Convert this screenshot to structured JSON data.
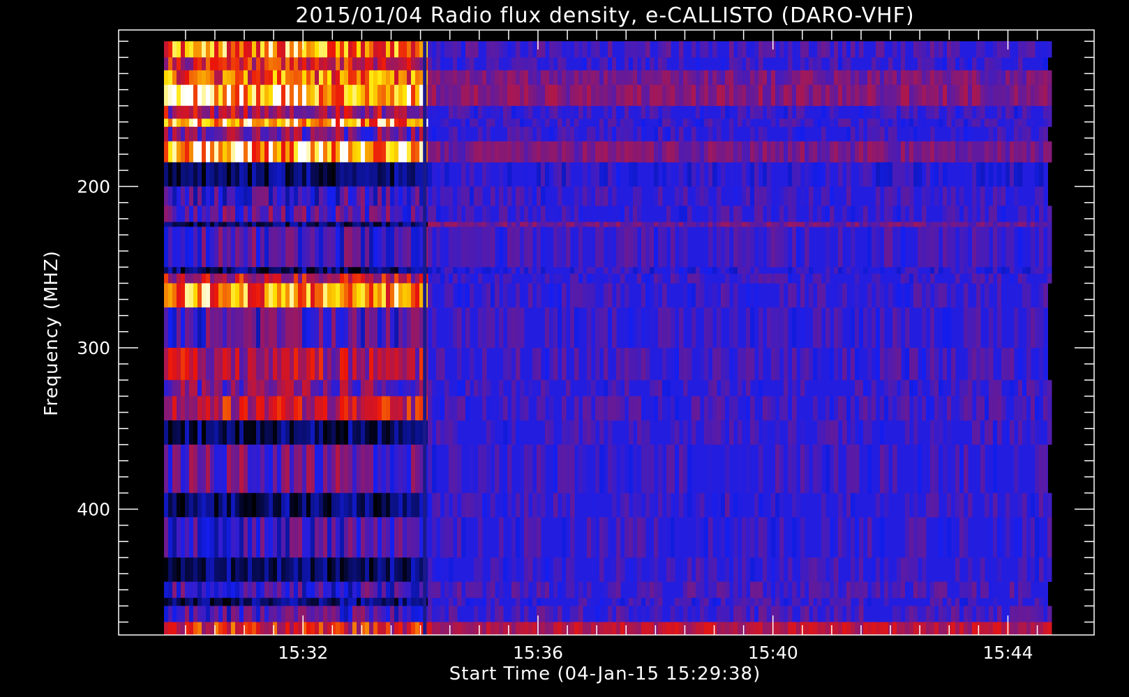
{
  "chart_data": {
    "type": "heatmap",
    "title": "2015/01/04  Radio flux density, e-CALLISTO (DARO-VHF)",
    "xlabel": "Start Time (04-Jan-15 15:29:38)",
    "ylabel": "Frequency (MHZ)",
    "x_ticks": [
      "15:32",
      "15:36",
      "15:40",
      "15:44"
    ],
    "y_ticks": [
      200,
      300,
      400
    ],
    "x_range": [
      "15:29:38",
      "15:44:41"
    ],
    "ylim": [
      478,
      103
    ],
    "ylim_note_removed": true,
    "event": {
      "time": "15:34:04"
    },
    "bands": [
      {
        "f0": 110,
        "f1": 120,
        "intensity_before": 0.85,
        "intensity_after": 0.15
      },
      {
        "f0": 120,
        "f1": 128,
        "intensity_before": 0.55,
        "intensity_after": 0.1
      },
      {
        "f0": 128,
        "f1": 137,
        "intensity_before": 0.75,
        "intensity_after": 0.3
      },
      {
        "f0": 137,
        "f1": 150,
        "intensity_before": 0.95,
        "intensity_after": 0.35
      },
      {
        "f0": 150,
        "f1": 158,
        "intensity_before": 0.45,
        "intensity_after": 0.1
      },
      {
        "f0": 158,
        "f1": 163,
        "intensity_before": 0.9,
        "intensity_after": 0.1
      },
      {
        "f0": 163,
        "f1": 172,
        "intensity_before": 0.3,
        "intensity_after": 0.1
      },
      {
        "f0": 172,
        "f1": 185,
        "intensity_before": 0.95,
        "intensity_after": 0.3
      },
      {
        "f0": 185,
        "f1": 200,
        "intensity_before": 0.05,
        "intensity_after": 0.05
      },
      {
        "f0": 200,
        "f1": 212,
        "intensity_before": 0.1,
        "intensity_after": 0.1
      },
      {
        "f0": 212,
        "f1": 222,
        "intensity_before": 0.2,
        "intensity_after": 0.1
      },
      {
        "f0": 222,
        "f1": 225,
        "intensity_before": 0.0,
        "intensity_after": 0.3
      },
      {
        "f0": 225,
        "f1": 250,
        "intensity_before": 0.15,
        "intensity_after": 0.12
      },
      {
        "f0": 250,
        "f1": 254,
        "intensity_before": 0.0,
        "intensity_after": 0.05
      },
      {
        "f0": 254,
        "f1": 260,
        "intensity_before": 0.5,
        "intensity_after": 0.1
      },
      {
        "f0": 260,
        "f1": 275,
        "intensity_before": 0.85,
        "intensity_after": 0.1
      },
      {
        "f0": 275,
        "f1": 300,
        "intensity_before": 0.15,
        "intensity_after": 0.1
      },
      {
        "f0": 300,
        "f1": 320,
        "intensity_before": 0.45,
        "intensity_after": 0.12
      },
      {
        "f0": 320,
        "f1": 330,
        "intensity_before": 0.3,
        "intensity_after": 0.1
      },
      {
        "f0": 330,
        "f1": 345,
        "intensity_before": 0.55,
        "intensity_after": 0.12
      },
      {
        "f0": 345,
        "f1": 360,
        "intensity_before": 0.05,
        "intensity_after": 0.1
      },
      {
        "f0": 360,
        "f1": 390,
        "intensity_before": 0.25,
        "intensity_after": 0.1
      },
      {
        "f0": 390,
        "f1": 405,
        "intensity_before": 0.05,
        "intensity_after": 0.1
      },
      {
        "f0": 405,
        "f1": 430,
        "intensity_before": 0.1,
        "intensity_after": 0.1
      },
      {
        "f0": 430,
        "f1": 445,
        "intensity_before": 0.05,
        "intensity_after": 0.1
      },
      {
        "f0": 445,
        "f1": 455,
        "intensity_before": 0.1,
        "intensity_after": 0.15
      },
      {
        "f0": 455,
        "f1": 460,
        "intensity_before": 0.0,
        "intensity_after": 0.1
      },
      {
        "f0": 460,
        "f1": 470,
        "intensity_before": 0.15,
        "intensity_after": 0.15
      },
      {
        "f0": 470,
        "f1": 478,
        "intensity_before": 0.6,
        "intensity_after": 0.5
      }
    ],
    "colormap": [
      "#000000",
      "#0000ff",
      "#ff0000",
      "#ffff00",
      "#ffffff"
    ],
    "grid": false,
    "legend": "none"
  }
}
